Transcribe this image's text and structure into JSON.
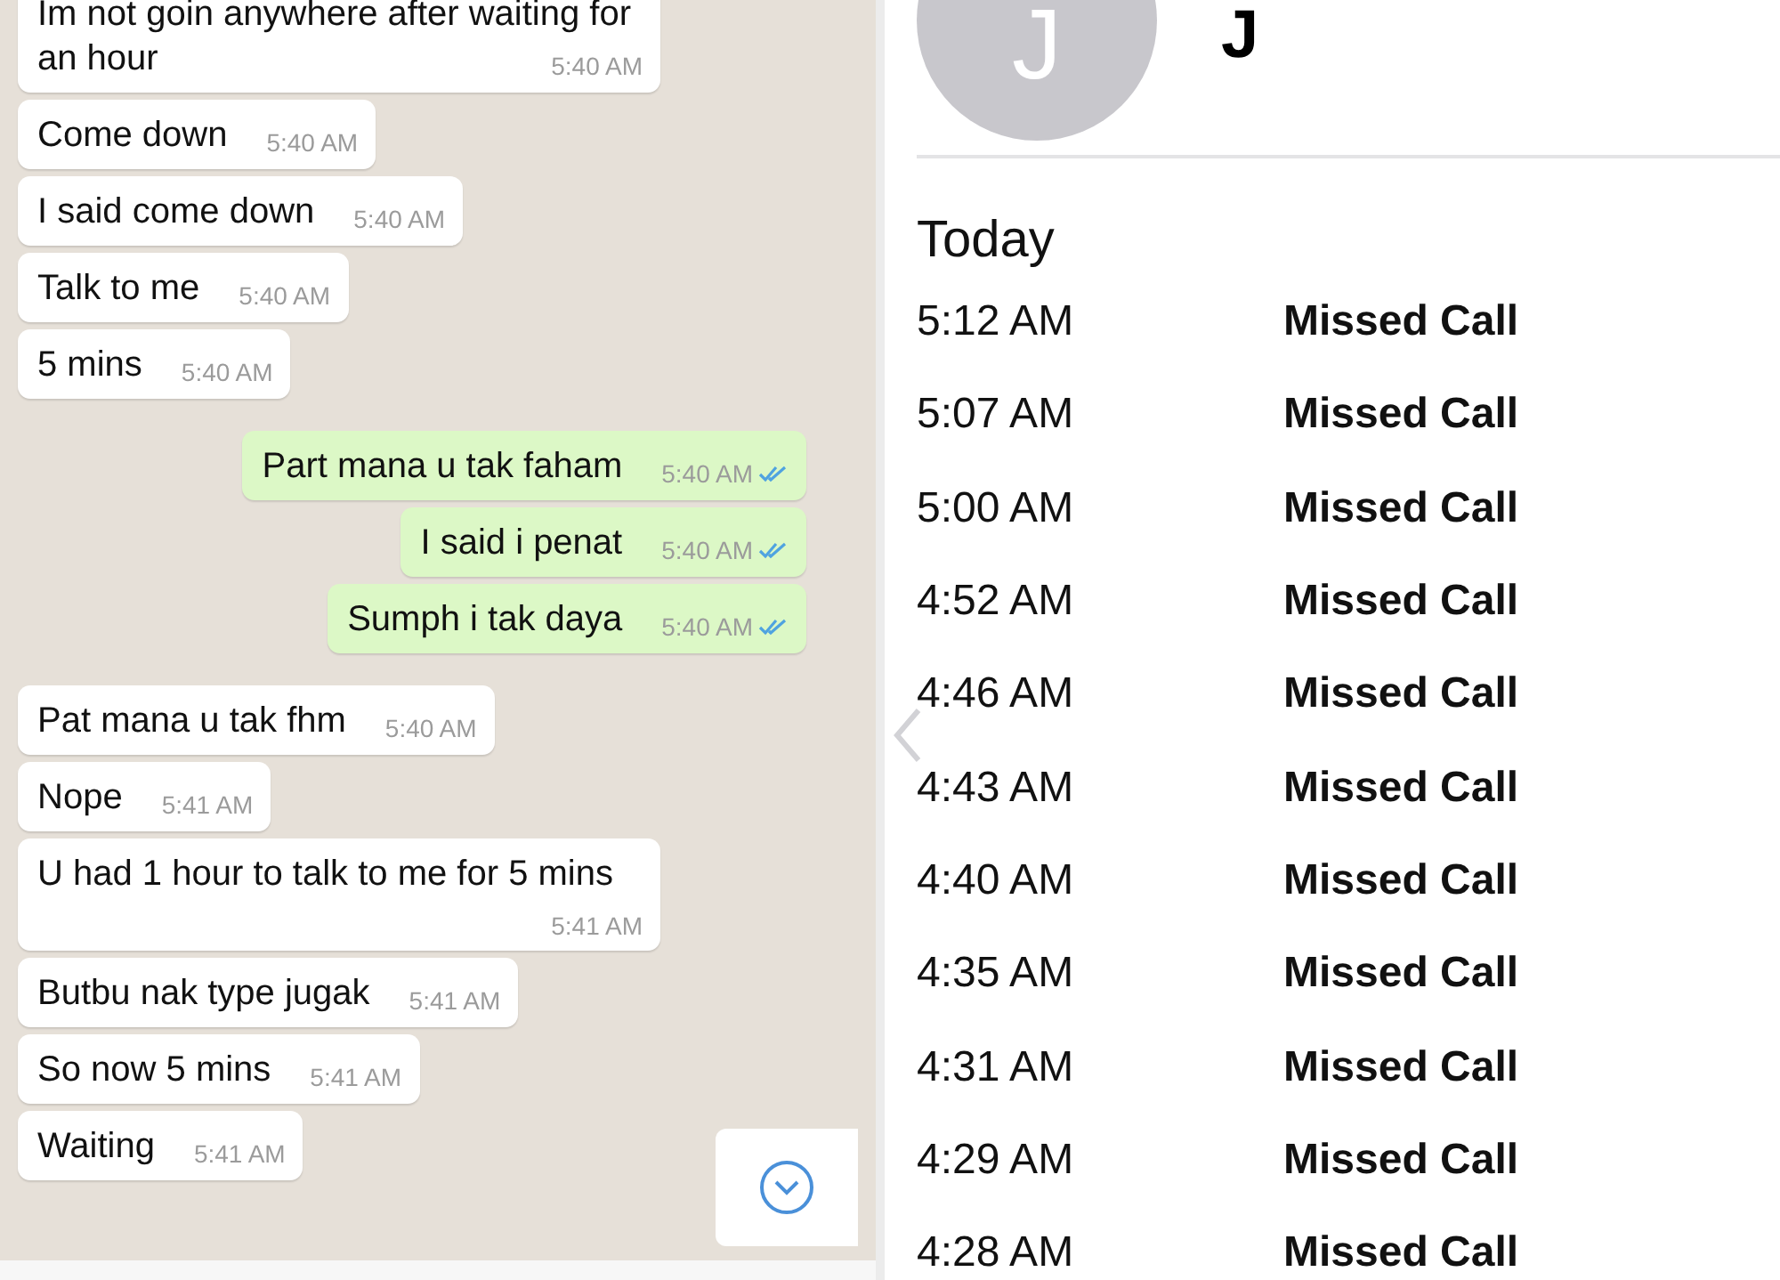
{
  "chat": {
    "messages": [
      {
        "kind": "incoming",
        "text": "Im not goin anywhere after waiting for an hour",
        "time": "5:40 AM"
      },
      {
        "kind": "incoming",
        "text": "Come down",
        "time": "5:40 AM"
      },
      {
        "kind": "incoming",
        "text": "I said come down",
        "time": "5:40 AM"
      },
      {
        "kind": "incoming",
        "text": "Talk to me",
        "time": "5:40 AM"
      },
      {
        "kind": "incoming",
        "text": "5 mins",
        "time": "5:40 AM"
      },
      {
        "kind": "outgoing",
        "text": "Part mana u tak faham",
        "time": "5:40 AM",
        "read": true
      },
      {
        "kind": "outgoing",
        "text": "I said i penat",
        "time": "5:40 AM",
        "read": true
      },
      {
        "kind": "outgoing",
        "text": "Sumph i tak daya",
        "time": "5:40 AM",
        "read": true
      },
      {
        "kind": "incoming",
        "text": "Pat mana u tak fhm",
        "time": "5:40 AM"
      },
      {
        "kind": "incoming",
        "text": "Nope",
        "time": "5:41 AM"
      },
      {
        "kind": "incoming",
        "text": "U had 1 hour to talk to me for 5 mins",
        "time": "5:41 AM"
      },
      {
        "kind": "incoming",
        "text": "Butbu nak type jugak",
        "time": "5:41 AM"
      },
      {
        "kind": "incoming",
        "text": "So now 5 mins",
        "time": "5:41 AM"
      },
      {
        "kind": "incoming",
        "text": "Waiting",
        "time": "5:41 AM"
      }
    ]
  },
  "contact": {
    "avatar_initial": "J",
    "name": "J"
  },
  "call_log": {
    "heading": "Today",
    "calls": [
      {
        "time": "5:12 AM",
        "type": "Missed Call"
      },
      {
        "time": "5:07 AM",
        "type": "Missed Call"
      },
      {
        "time": "5:00 AM",
        "type": "Missed Call"
      },
      {
        "time": "4:52 AM",
        "type": "Missed Call"
      },
      {
        "time": "4:46 AM",
        "type": "Missed Call"
      },
      {
        "time": "4:43 AM",
        "type": "Missed Call"
      },
      {
        "time": "4:40 AM",
        "type": "Missed Call"
      },
      {
        "time": "4:35 AM",
        "type": "Missed Call"
      },
      {
        "time": "4:31 AM",
        "type": "Missed Call"
      },
      {
        "time": "4:29 AM",
        "type": "Missed Call"
      },
      {
        "time": "4:28 AM",
        "type": "Missed Call"
      }
    ]
  }
}
